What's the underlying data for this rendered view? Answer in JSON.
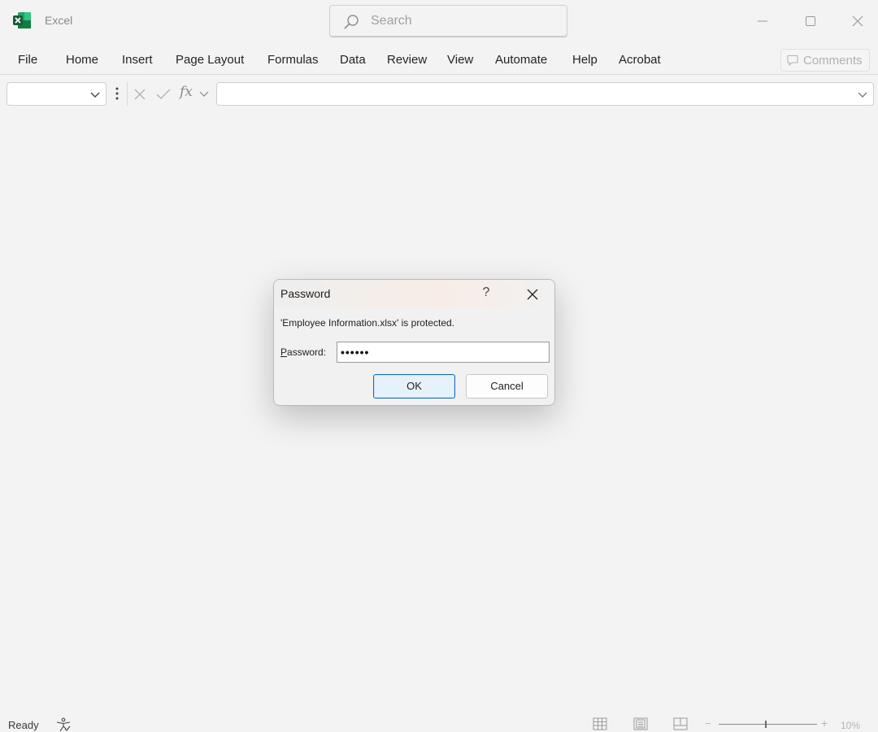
{
  "app": {
    "name": "Excel",
    "brand_color": "#107c41"
  },
  "search": {
    "placeholder": "Search"
  },
  "ribbon": {
    "tabs": [
      {
        "label": "File"
      },
      {
        "label": "Home"
      },
      {
        "label": "Insert"
      },
      {
        "label": "Page Layout"
      },
      {
        "label": "Formulas"
      },
      {
        "label": "Data"
      },
      {
        "label": "Review"
      },
      {
        "label": "View"
      },
      {
        "label": "Automate"
      },
      {
        "label": "Help"
      },
      {
        "label": "Acrobat"
      }
    ],
    "comments_label": "Comments"
  },
  "formula_bar": {
    "fx_label": "fx",
    "name_box_value": "",
    "formula_value": ""
  },
  "dialog": {
    "title": "Password",
    "help_label": "?",
    "message": "'Employee Information.xlsx' is protected.",
    "password_label_first": "P",
    "password_label_rest": "assword:",
    "password_value": "••••••",
    "ok_label": "OK",
    "cancel_label": "Cancel"
  },
  "status_bar": {
    "status_text": "Ready",
    "zoom_text": "10%",
    "zoom_fraction": 0.48
  }
}
